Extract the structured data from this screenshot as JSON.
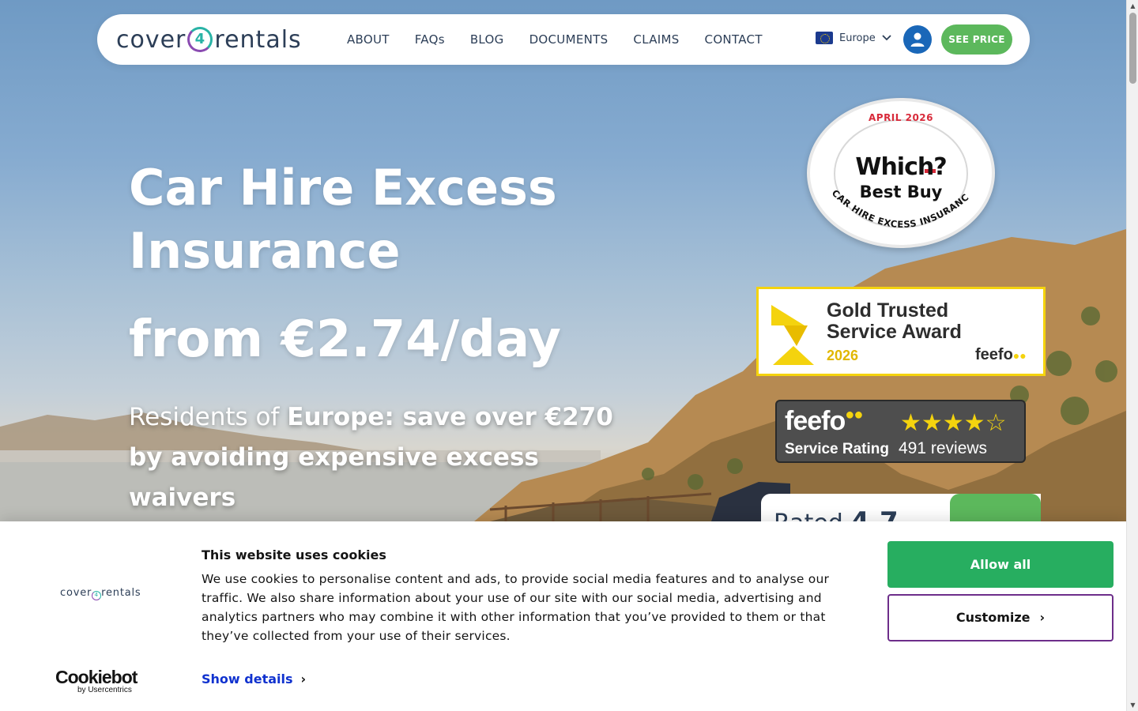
{
  "nav": {
    "logo_left": "cover",
    "logo_mid": "4",
    "logo_right": "rentals",
    "links": [
      "ABOUT",
      "FAQs",
      "BLOG",
      "DOCUMENTS",
      "CLAIMS",
      "CONTACT"
    ],
    "region": "Europe",
    "see_price": "SEE PRICE"
  },
  "hero": {
    "title": "Car Hire Excess Insurance",
    "price": "from €2.74/day",
    "sub_prefix": "Residents of ",
    "sub_bold": "Europe: save over €270 by avoiding expensive excess waivers"
  },
  "which_badge": {
    "date": "APRIL 2026",
    "name": "Which?",
    "buy": "Best Buy",
    "arc": "CAR HIRE EXCESS INSURANCE"
  },
  "gold_award": {
    "title": "Gold Trusted Service Award",
    "year": "2026",
    "brand": "feefo"
  },
  "feefo_rating": {
    "brand": "feefo",
    "label": "Service Rating",
    "stars": "★★★★",
    "half_star": "☆",
    "rating_value": 4.5,
    "reviews": "491 reviews"
  },
  "rated_card": {
    "prefix": "Rated",
    "value": "4.7"
  },
  "cookie": {
    "logo_left": "cover",
    "logo_mid": "4",
    "logo_right": "rentals",
    "title": "This website uses cookies",
    "body": "We use cookies to personalise content and ads, to provide social media features and to analyse our traffic. We also share information about your use of our site with our social media, advertising and analytics partners who may combine it with other information that you’ve provided to them or that they’ve collected from your use of their services.",
    "show_details": "Show details",
    "allow_all": "Allow all",
    "customize": "Customize",
    "brand_name": "Cookiebot",
    "brand_by": "by Usercentrics"
  },
  "colors": {
    "accent_green": "#5cb85c",
    "allow_green": "#27ae60",
    "navy": "#2c3e57",
    "link_blue": "#1032cf",
    "feefo_yellow": "#f4d30e"
  },
  "icons": [
    "chevron-down-icon",
    "user-icon",
    "eu-flag-icon",
    "star-icon",
    "chevron-right-icon",
    "scroll-up-icon",
    "scroll-down-icon"
  ]
}
